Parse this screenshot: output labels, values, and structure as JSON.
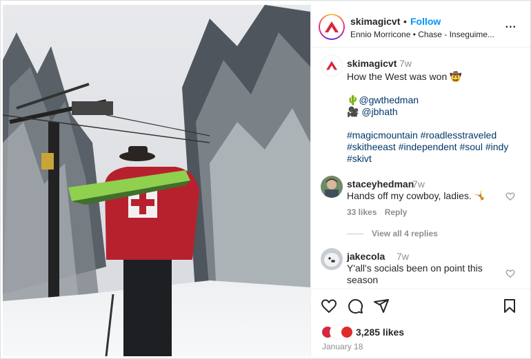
{
  "post": {
    "username": "skimagicvt",
    "separator": "•",
    "follow_label": "Follow",
    "audio": "Ennio Morricone • Chase - Inseguime...",
    "more_label": "..."
  },
  "caption": {
    "username": "skimagicvt",
    "time": "7w",
    "line1": "How the West was won 🤠",
    "line2_prefix": "🌵",
    "line2_mention": "@gwthedman",
    "line3_prefix": "🎥 ",
    "line3_mention": "@jbhath",
    "hashtags_line1": "#magicmountain #roadlesstraveled",
    "hashtags_line2": "#skitheeast #independent #soul #indy",
    "hashtags_line3": "#skivt"
  },
  "comments": [
    {
      "username": "staceyhedman",
      "time": "7w",
      "text": "Hands off my cowboy, ladies. 🤸",
      "likes": "33 likes",
      "reply_label": "Reply",
      "view_replies": "View all 4 replies"
    },
    {
      "username": "jakecola",
      "time": "7w",
      "text_line1": "Y'all's socials been on point this",
      "text_line2": "season"
    }
  ],
  "footer": {
    "likes": "3,285 likes",
    "date": "January 18"
  },
  "icons": {
    "like": "heart-icon",
    "comment": "comment-icon",
    "share": "share-icon",
    "save": "bookmark-icon",
    "more": "more-icon"
  },
  "colors": {
    "accent": "#0095f6",
    "link": "#00376b",
    "muted": "#8e8e8e",
    "brand_red": "#d7263d"
  }
}
